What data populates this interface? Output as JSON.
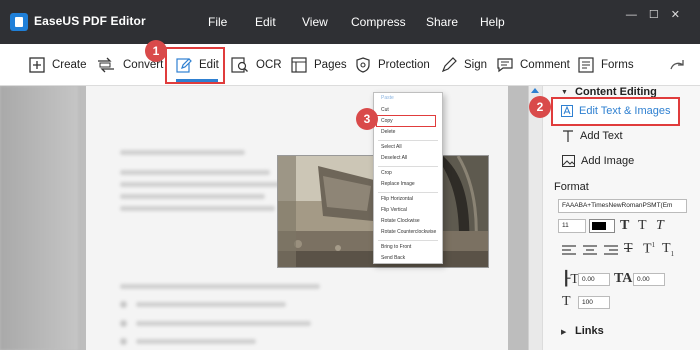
{
  "app": {
    "title": "EaseUS PDF Editor"
  },
  "menu": [
    "File",
    "Edit",
    "View",
    "Compress",
    "Share",
    "Help"
  ],
  "toolbar": {
    "create": "Create",
    "convert": "Convert",
    "edit": "Edit",
    "ocr": "OCR",
    "pages": "Pages",
    "protection": "Protection",
    "sign": "Sign",
    "comment": "Comment",
    "forms": "Forms"
  },
  "context_menu": {
    "items": [
      "Paste",
      "Cut",
      "Copy",
      "Delete",
      "Select All",
      "Deselect All",
      "Crop",
      "Replace Image",
      "Flip Horizontal",
      "Flip Vertical",
      "Rotate Clockwise",
      "Rotate Counterclockwise",
      "Bring to Front",
      "Send Back"
    ]
  },
  "steps": [
    "1",
    "2",
    "3"
  ],
  "panel": {
    "section_title": "Content Editing",
    "edit_text_images": "Edit Text & Images",
    "add_text": "Add Text",
    "add_image": "Add Image",
    "format_label": "Format",
    "font_name": "FAAABA+TimesNewRomanPSMT(Em",
    "font_size": "11",
    "char_spacing": "0.00",
    "word_spacing": "0.00",
    "scale": "100",
    "links_label": "Links"
  },
  "colors": {
    "accent": "#2f80d1",
    "highlight": "#e03c3c",
    "badge": "#d94a4a",
    "titlebar": "#2f3034"
  }
}
